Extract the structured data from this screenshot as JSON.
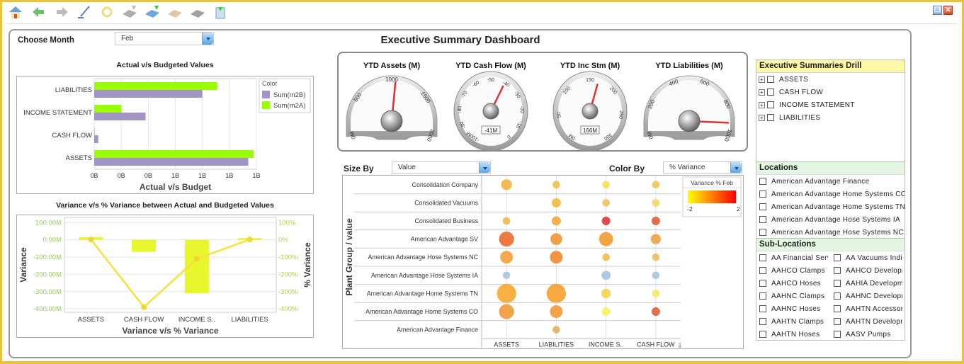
{
  "toolbar": {
    "icons": [
      "home-icon",
      "back-arrow-icon",
      "forward-arrow-icon",
      "edit-pen-icon",
      "refresh-icon",
      "add-drive-icon",
      "download-drive-icon",
      "email-icon",
      "print-icon",
      "export-icon"
    ]
  },
  "window": {
    "restore": "❐",
    "close": "✕"
  },
  "header": {
    "choose_month_label": "Choose Month",
    "month_value": "Feb",
    "title": "Executive Summary Dashboard"
  },
  "colors": {
    "budget": "#a294c6",
    "actual": "#99ff00",
    "variance_bar": "#e5f516",
    "variance_line": "#f5e23c",
    "axis_green": "#8fce5a",
    "frame": "#e6c43c"
  },
  "chart_data": [
    {
      "type": "bar",
      "orientation": "horizontal",
      "title": "Actual v/s Budgeted Values",
      "xlabel": "Actual v/s Budget",
      "categories": [
        "LIABILITIES",
        "INCOME STATEMENT",
        "CASH FLOW",
        "ASSETS"
      ],
      "xticks": [
        0,
        0.2,
        0.4,
        0.6,
        0.8,
        1.0,
        1.2
      ],
      "xtick_labels": [
        "0B",
        "0B",
        "0B",
        "1B",
        "1B",
        "1B",
        "1B"
      ],
      "xlim": [
        0,
        1.2
      ],
      "legend": {
        "title": "Color",
        "placement": "right"
      },
      "series": [
        {
          "name": "Sum(m2A)",
          "values": [
            0.91,
            0.2,
            0.005,
            1.18
          ]
        },
        {
          "name": "Sum(m2B)",
          "values": [
            0.8,
            0.38,
            0.03,
            1.14
          ]
        }
      ]
    },
    {
      "type": "bar+line",
      "title": "Variance v/s % Variance between Actual and Budgeted Values",
      "xlabel": "Variance v/s % Variance",
      "ylabel": "Variance",
      "y2label": "% Variance",
      "categories": [
        "ASSETS",
        "CASH FLOW",
        "INCOME S..",
        "LIABILITIES"
      ],
      "ylim": [
        -420,
        130
      ],
      "yticks": [
        100,
        0,
        -100,
        -200,
        -300,
        -400
      ],
      "ytick_labels": [
        "100.00M",
        "0.00M",
        "-100.00M",
        "-200.00M",
        "-300.00M",
        "-400.00M"
      ],
      "y2ticks": [
        100,
        0,
        -100,
        -200,
        -300,
        -400
      ],
      "y2tick_labels": [
        "100%",
        "0%",
        "-100%",
        "-200%",
        "-300%",
        "-400%"
      ],
      "bars": {
        "values": [
          15,
          -70,
          -310,
          10
        ]
      },
      "line": {
        "values": [
          2,
          -390,
          -110,
          2
        ]
      }
    },
    {
      "type": "scatter",
      "subtype": "bubble",
      "ylabel": "Plant Group / value",
      "columns": [
        "ASSETS",
        "LIABILITIES",
        "INCOME S..",
        "CASH FLOW"
      ],
      "rows": [
        "Consolidation Company",
        "Consolidated Vacuums",
        "Consolidated Business",
        "American Advantage SV",
        "American Advantage Hose Systems NC",
        "American Advantage Hose Systems  IA",
        "American Advantage Home Systems TN",
        "American Advantage Home Systems CO",
        "American Advantage Finance"
      ],
      "bubbles": [
        [
          {
            "s": 2,
            "c": "#f4b23c"
          },
          {
            "s": 1,
            "c": "#f0c040"
          },
          {
            "s": 1,
            "c": "#f6e050"
          },
          {
            "s": 1,
            "c": "#f0c850"
          }
        ],
        [
          null,
          {
            "s": 1.5,
            "c": "#f4b83a"
          },
          {
            "s": 1,
            "c": "#eec060"
          },
          {
            "s": 1,
            "c": "#f4d860"
          }
        ],
        [
          {
            "s": 1,
            "c": "#f0b850"
          },
          {
            "s": 1.5,
            "c": "#f4a838"
          },
          {
            "s": 1.3,
            "c": "#d8383a"
          },
          {
            "s": 1.3,
            "c": "#e0603a"
          }
        ],
        [
          {
            "s": 3.3,
            "c": "#ee6a2e"
          },
          {
            "s": 2.3,
            "c": "#f29436"
          },
          {
            "s": 3,
            "c": "#f49a30"
          },
          {
            "s": 1.8,
            "c": "#f0a048"
          }
        ],
        [
          {
            "s": 2.6,
            "c": "#f4a038"
          },
          {
            "s": 2.6,
            "c": "#f08830"
          },
          {
            "s": 1,
            "c": "#eebc50"
          },
          {
            "s": 1,
            "c": "#eebc60"
          }
        ],
        [
          {
            "s": 1,
            "c": "#a8c4e0"
          },
          null,
          {
            "s": 1.5,
            "c": "#a8c4e0"
          },
          {
            "s": 1,
            "c": "#a8c4e0"
          }
        ],
        [
          {
            "s": 4.6,
            "c": "#f6a830"
          },
          {
            "s": 4.6,
            "c": "#f6a030"
          },
          {
            "s": 1.6,
            "c": "#f6d448"
          },
          {
            "s": 1,
            "c": "#f6e860"
          }
        ],
        [
          {
            "s": 3.3,
            "c": "#f29a36"
          },
          {
            "s": 2.6,
            "c": "#f29834"
          },
          {
            "s": 1.3,
            "c": "#f8f060"
          },
          {
            "s": 1.3,
            "c": "#e06038"
          }
        ],
        [
          null,
          {
            "s": 1,
            "c": "#e0b060"
          },
          null,
          null
        ]
      ],
      "legend": {
        "title": "Variance % Feb",
        "min_label": "-2",
        "max_label": "2",
        "colors": [
          "#ffff00",
          "#ff0000"
        ],
        "placement": "right"
      }
    }
  ],
  "bubble_controls": {
    "size_by_label": "Size By",
    "size_by_value": "Value",
    "color_by_label": "Color By",
    "color_by_value": "% Variance"
  },
  "gauges": [
    {
      "title": "YTD Assets (M)",
      "style": "half",
      "min": 0,
      "max": 2000,
      "value": 1050,
      "ticks": [
        "0M",
        "500",
        "1000",
        "1500",
        "2000"
      ],
      "readout": ""
    },
    {
      "title": "YTD Cash Flow (M)",
      "style": "round",
      "min": -100,
      "max": 0,
      "value": -41,
      "ticks": [
        "-100M",
        "-90",
        "-80",
        "-70",
        "-60",
        "-50",
        "-40",
        "-30",
        "-20",
        "-10",
        "0"
      ],
      "readout": "-41M"
    },
    {
      "title": "YTD Inc Stm (M)",
      "style": "round",
      "min": 0,
      "max": 300,
      "value": 166,
      "ticks": [
        "0M",
        "50",
        "100",
        "150",
        "200",
        "250",
        "300"
      ],
      "readout": "166M"
    },
    {
      "title": "YTD Liabilities (M)",
      "style": "half",
      "min": 0,
      "max": 1000,
      "value": 920,
      "ticks": [
        "0M",
        "200",
        "400",
        "600",
        "800",
        "1000"
      ],
      "readout": ""
    }
  ],
  "drill": {
    "title": "Executive Summaries Drill",
    "items": [
      "ASSETS",
      "CASH FLOW",
      "INCOME STATEMENT",
      "LIABILITIES"
    ]
  },
  "locations": {
    "title": "Locations",
    "items": [
      "American Advantage Finance",
      "American Advantage Home Systems CO",
      "American Advantage Home Systems TN",
      "American Advantage Hose Systems  IA",
      "American Advantage Hose Systems NC"
    ]
  },
  "sublocations": {
    "title": "Sub-Locations",
    "items": [
      "AA Financial Services",
      "AA Vacuums India",
      "AAHCO Clamps",
      "AAHCO Development",
      "AAHCO Hoses",
      "AAHIA Development",
      "AAHNC Clamps",
      "AAHNC Development",
      "AAHNC Hoses",
      "AAHTN Accessories",
      "AAHTN Clamps",
      "AAHTN Development",
      "AAHTN Hoses",
      "AASV Pumps"
    ]
  }
}
